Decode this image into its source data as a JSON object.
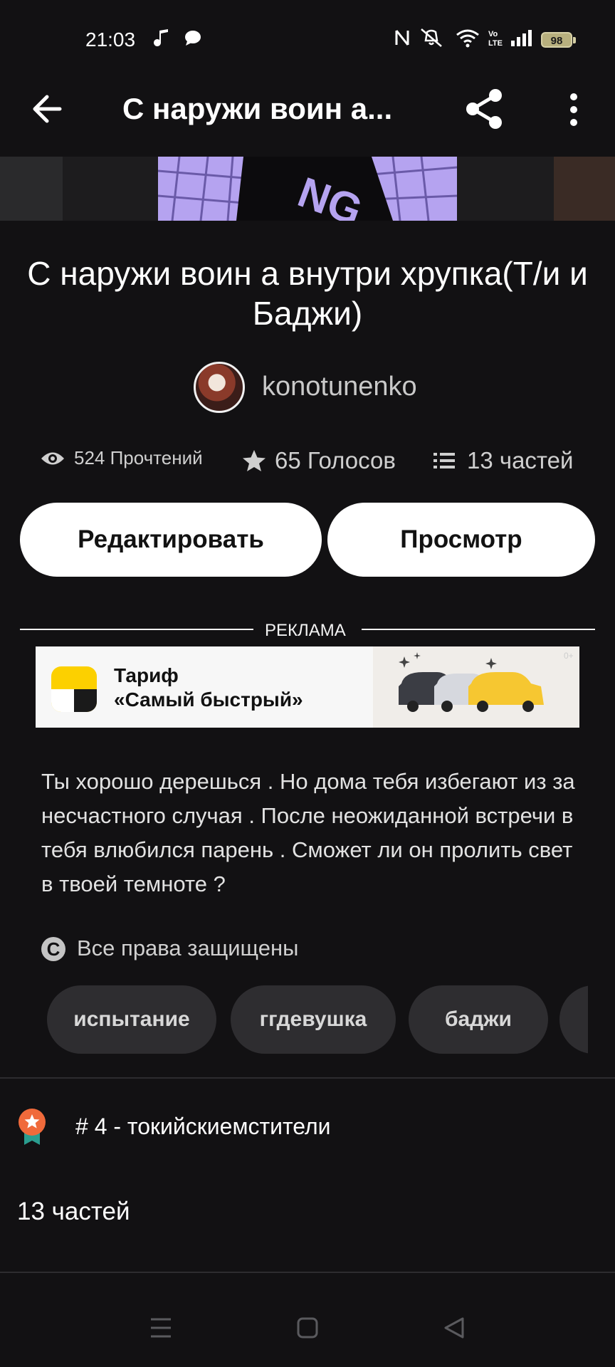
{
  "status_bar": {
    "time": "21:03",
    "battery": "98"
  },
  "app_bar": {
    "title": "С наружи  воин а..."
  },
  "story": {
    "title": "С наружи  воин а внутри хрупка(Т/и и Баджи)",
    "author": "konotunenko",
    "reads": "524 Прочтений",
    "votes": "65 Голосов",
    "parts": "13 частей",
    "edit_label": "Редактировать",
    "preview_label": "Просмотр",
    "description": "Ты хорошо дерешься . Но дома тебя избегают из за несчастного случая . После неожиданной встречи в тебя влюбился парень . Сможет ли он пролить свет в твоей темноте ?",
    "copyright": "Все права защищены",
    "tags": [
      "испытание",
      "ггдевушка",
      "баджи"
    ],
    "ranking": "# 4 - токийскиемстители",
    "parts_heading": "13 частей"
  },
  "ad": {
    "label": "РЕКЛАМА",
    "line1": "Тариф",
    "line2": "«Самый быстрый»",
    "age": "0+"
  },
  "colors": {
    "background": "#121113",
    "tag_bg": "#2e2d30",
    "badge_orange": "#f06a3b",
    "badge_teal": "#2a9d8f",
    "yandex_yellow": "#fcd000"
  },
  "icons": [
    "back-arrow-icon",
    "share-icon",
    "more-vert-icon",
    "eye-icon",
    "star-icon",
    "list-icon",
    "copyright-icon",
    "rank-badge-icon",
    "menu-icon",
    "home-square-icon",
    "back-triangle-icon"
  ]
}
